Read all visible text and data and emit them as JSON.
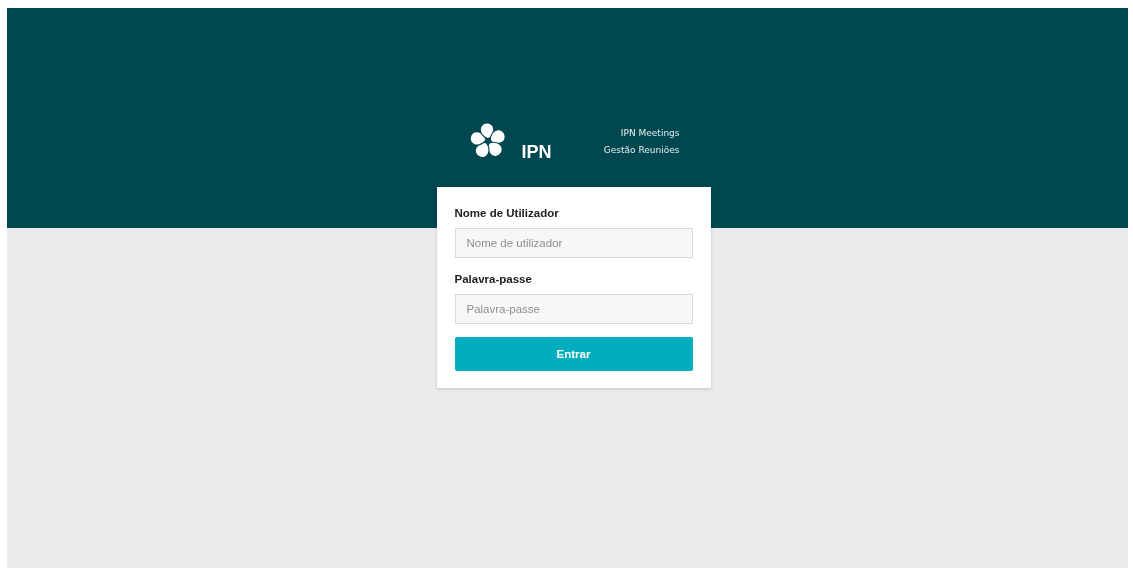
{
  "header": {
    "logo_text": "IPN",
    "app_name": "IPN Meetings",
    "app_subtitle": "Gestão Reuniões"
  },
  "login_form": {
    "fields": [
      {
        "label": "Nome de Utilizador",
        "placeholder": "Nome de utilizador"
      },
      {
        "label": "Palavra-passe",
        "placeholder": "Palavra-passe"
      }
    ],
    "submit_button": "Entrar"
  }
}
